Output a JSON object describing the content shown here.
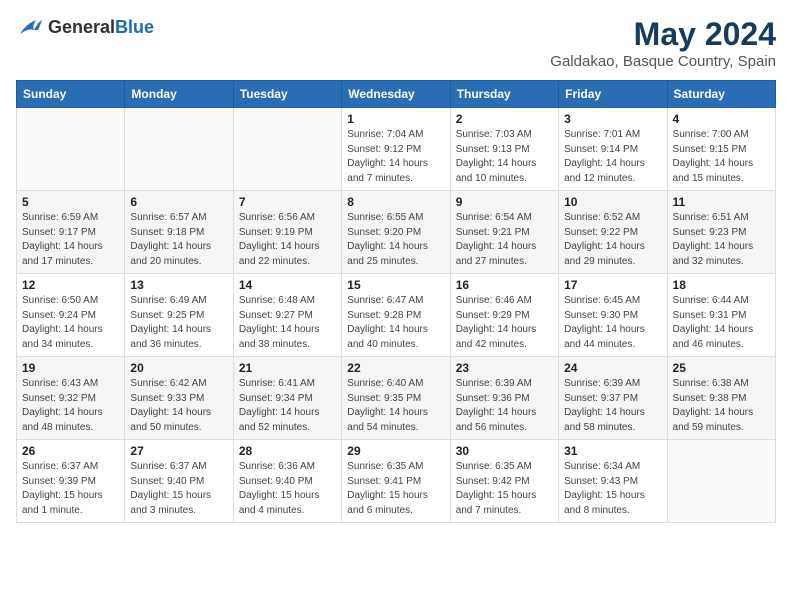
{
  "header": {
    "logo_general": "General",
    "logo_blue": "Blue",
    "title": "May 2024",
    "subtitle": "Galdakao, Basque Country, Spain"
  },
  "days_of_week": [
    "Sunday",
    "Monday",
    "Tuesday",
    "Wednesday",
    "Thursday",
    "Friday",
    "Saturday"
  ],
  "weeks": [
    [
      {
        "day": "",
        "info": ""
      },
      {
        "day": "",
        "info": ""
      },
      {
        "day": "",
        "info": ""
      },
      {
        "day": "1",
        "info": "Sunrise: 7:04 AM\nSunset: 9:12 PM\nDaylight: 14 hours\nand 7 minutes."
      },
      {
        "day": "2",
        "info": "Sunrise: 7:03 AM\nSunset: 9:13 PM\nDaylight: 14 hours\nand 10 minutes."
      },
      {
        "day": "3",
        "info": "Sunrise: 7:01 AM\nSunset: 9:14 PM\nDaylight: 14 hours\nand 12 minutes."
      },
      {
        "day": "4",
        "info": "Sunrise: 7:00 AM\nSunset: 9:15 PM\nDaylight: 14 hours\nand 15 minutes."
      }
    ],
    [
      {
        "day": "5",
        "info": "Sunrise: 6:59 AM\nSunset: 9:17 PM\nDaylight: 14 hours\nand 17 minutes."
      },
      {
        "day": "6",
        "info": "Sunrise: 6:57 AM\nSunset: 9:18 PM\nDaylight: 14 hours\nand 20 minutes."
      },
      {
        "day": "7",
        "info": "Sunrise: 6:56 AM\nSunset: 9:19 PM\nDaylight: 14 hours\nand 22 minutes."
      },
      {
        "day": "8",
        "info": "Sunrise: 6:55 AM\nSunset: 9:20 PM\nDaylight: 14 hours\nand 25 minutes."
      },
      {
        "day": "9",
        "info": "Sunrise: 6:54 AM\nSunset: 9:21 PM\nDaylight: 14 hours\nand 27 minutes."
      },
      {
        "day": "10",
        "info": "Sunrise: 6:52 AM\nSunset: 9:22 PM\nDaylight: 14 hours\nand 29 minutes."
      },
      {
        "day": "11",
        "info": "Sunrise: 6:51 AM\nSunset: 9:23 PM\nDaylight: 14 hours\nand 32 minutes."
      }
    ],
    [
      {
        "day": "12",
        "info": "Sunrise: 6:50 AM\nSunset: 9:24 PM\nDaylight: 14 hours\nand 34 minutes."
      },
      {
        "day": "13",
        "info": "Sunrise: 6:49 AM\nSunset: 9:25 PM\nDaylight: 14 hours\nand 36 minutes."
      },
      {
        "day": "14",
        "info": "Sunrise: 6:48 AM\nSunset: 9:27 PM\nDaylight: 14 hours\nand 38 minutes."
      },
      {
        "day": "15",
        "info": "Sunrise: 6:47 AM\nSunset: 9:28 PM\nDaylight: 14 hours\nand 40 minutes."
      },
      {
        "day": "16",
        "info": "Sunrise: 6:46 AM\nSunset: 9:29 PM\nDaylight: 14 hours\nand 42 minutes."
      },
      {
        "day": "17",
        "info": "Sunrise: 6:45 AM\nSunset: 9:30 PM\nDaylight: 14 hours\nand 44 minutes."
      },
      {
        "day": "18",
        "info": "Sunrise: 6:44 AM\nSunset: 9:31 PM\nDaylight: 14 hours\nand 46 minutes."
      }
    ],
    [
      {
        "day": "19",
        "info": "Sunrise: 6:43 AM\nSunset: 9:32 PM\nDaylight: 14 hours\nand 48 minutes."
      },
      {
        "day": "20",
        "info": "Sunrise: 6:42 AM\nSunset: 9:33 PM\nDaylight: 14 hours\nand 50 minutes."
      },
      {
        "day": "21",
        "info": "Sunrise: 6:41 AM\nSunset: 9:34 PM\nDaylight: 14 hours\nand 52 minutes."
      },
      {
        "day": "22",
        "info": "Sunrise: 6:40 AM\nSunset: 9:35 PM\nDaylight: 14 hours\nand 54 minutes."
      },
      {
        "day": "23",
        "info": "Sunrise: 6:39 AM\nSunset: 9:36 PM\nDaylight: 14 hours\nand 56 minutes."
      },
      {
        "day": "24",
        "info": "Sunrise: 6:39 AM\nSunset: 9:37 PM\nDaylight: 14 hours\nand 58 minutes."
      },
      {
        "day": "25",
        "info": "Sunrise: 6:38 AM\nSunset: 9:38 PM\nDaylight: 14 hours\nand 59 minutes."
      }
    ],
    [
      {
        "day": "26",
        "info": "Sunrise: 6:37 AM\nSunset: 9:39 PM\nDaylight: 15 hours\nand 1 minute."
      },
      {
        "day": "27",
        "info": "Sunrise: 6:37 AM\nSunset: 9:40 PM\nDaylight: 15 hours\nand 3 minutes."
      },
      {
        "day": "28",
        "info": "Sunrise: 6:36 AM\nSunset: 9:40 PM\nDaylight: 15 hours\nand 4 minutes."
      },
      {
        "day": "29",
        "info": "Sunrise: 6:35 AM\nSunset: 9:41 PM\nDaylight: 15 hours\nand 6 minutes."
      },
      {
        "day": "30",
        "info": "Sunrise: 6:35 AM\nSunset: 9:42 PM\nDaylight: 15 hours\nand 7 minutes."
      },
      {
        "day": "31",
        "info": "Sunrise: 6:34 AM\nSunset: 9:43 PM\nDaylight: 15 hours\nand 8 minutes."
      },
      {
        "day": "",
        "info": ""
      }
    ]
  ]
}
